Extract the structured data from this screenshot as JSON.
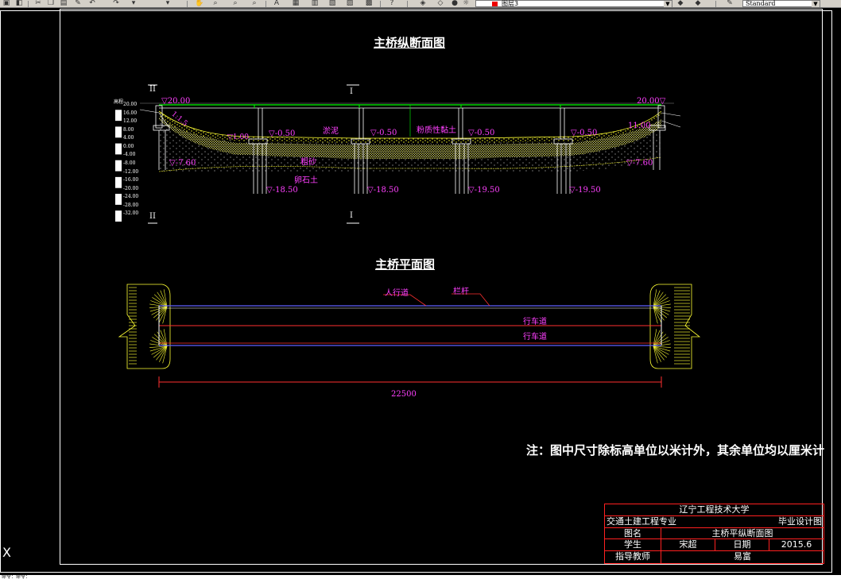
{
  "toolbar": {
    "layer_name": "图层3",
    "style_name": "Standard",
    "icons": [
      "open-icon",
      "save-icon",
      "print-icon",
      "cut-icon",
      "copy-icon",
      "paste-icon",
      "match-icon",
      "undo-icon",
      "redo-icon",
      "pan-icon",
      "zoom-realtime-icon",
      "zoom-window-icon",
      "zoom-previous-icon",
      "properties-icon",
      "design-center-icon",
      "tool-palette-icon",
      "markup-icon",
      "calc-icon",
      "help-icon",
      "layer-manager-icon",
      "layer-state-icon",
      "color-icon",
      "plot-style-icon"
    ]
  },
  "drawing": {
    "longitudinal_title": "主桥纵断面图",
    "plan_title": "主桥平面图",
    "note": "注：图中尺寸除标高单位以米计外，其余单位均以厘米计",
    "section_marks": {
      "left": "II",
      "center": "I"
    },
    "elevation_scale": {
      "header": "高程",
      "ticks": [
        "20.00",
        "16.00",
        "12.00",
        "8.00",
        "4.00",
        "0.00",
        "-4.00",
        "-8.00",
        "-12.00",
        "-16.00",
        "-20.00",
        "-24.00",
        "-28.00",
        "-32.00"
      ]
    },
    "elevations": {
      "deck_left": "20.00",
      "deck_right": "20.00",
      "bank_right": "11.00",
      "slope": "1:1.5",
      "left_bank_water": "1.00",
      "pier1_top": "-0.50",
      "pier2_top": "-0.50",
      "pier3_top": "-0.50",
      "pier4_top": "-0.50",
      "abutment_left_base": "-7.60",
      "abutment_right_base": "-7.60",
      "pile1_tip": "-18.50",
      "pile2_tip": "-18.50",
      "pile3_tip": "-19.50",
      "pile4_tip": "-19.50"
    },
    "soil_labels": {
      "silt": "淤泥",
      "silty_clay": "粉质性黏土",
      "coarse_sand": "粗砂",
      "gravel": "卵石土"
    },
    "plan_labels": {
      "sidewalk": "人行道",
      "railing": "栏杆",
      "lane1": "行车道",
      "lane2": "行车道",
      "span_length": "22500"
    }
  },
  "title_block": {
    "school": "辽宁工程技术大学",
    "major": "交通土建工程专业",
    "doc_type": "毕业设计图",
    "drawing_name_label": "图名",
    "drawing_name": "主桥平纵断面图",
    "student_label": "学生",
    "student_name": "宋超",
    "date_label": "日期",
    "date": "2015.6",
    "advisor_label": "指导教师",
    "advisor_name": "易富"
  },
  "command_line": {
    "text": "命令：命令："
  },
  "colors": {
    "background": "#000000",
    "dimension_text": "#ff40ff",
    "pier_lines": "#ffffff",
    "soil_fill": "#ffff33",
    "deck_green": "#00ff00",
    "road_blue": "#6060ff",
    "road_red": "#ff3030",
    "title_block_red": "#ff2020"
  }
}
